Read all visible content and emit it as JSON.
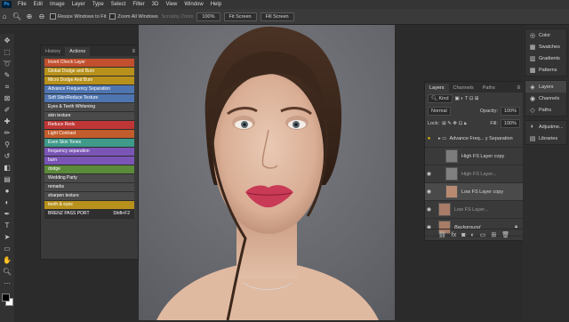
{
  "menubar": {
    "logo": "Ps",
    "items": [
      "File",
      "Edit",
      "Image",
      "Layer",
      "Type",
      "Select",
      "Filter",
      "3D",
      "View",
      "Window",
      "Help"
    ]
  },
  "options": {
    "resize_windows": "Resize Windows to Fit",
    "zoom_all": "Zoom All Windows",
    "scrubby_zoom": "Scrubby Zoom",
    "zoom_value": "100%",
    "fit_screen": "Fit Screen",
    "fill_screen": "Fill Screen"
  },
  "actions_panel": {
    "tabs": [
      "History",
      "Actions"
    ],
    "items": [
      {
        "label": "Invert Check Layer",
        "color": "#c2502f",
        "key": ""
      },
      {
        "label": "Global Dodge and Burn",
        "color": "#b8911c",
        "key": ""
      },
      {
        "label": "Micro Dodge And Burn",
        "color": "#b8911c",
        "key": ""
      },
      {
        "label": "Advance Frequency Separation",
        "color": "#4f75b0",
        "key": ""
      },
      {
        "label": "Soft Skin/Reduce Texture",
        "color": "#4f75b0",
        "key": ""
      },
      {
        "label": "Eyes & Teeth Whitening",
        "color": "#4a4a4a",
        "key": ""
      },
      {
        "label": "skin texture",
        "color": "#4a4a4a",
        "key": ""
      },
      {
        "label": "Reduce Reds",
        "color": "#bf3636",
        "key": ""
      },
      {
        "label": "Light Contrast",
        "color": "#c25c2c",
        "key": ""
      },
      {
        "label": "Even Skin Tones",
        "color": "#3f9a8a",
        "key": ""
      },
      {
        "label": "frequency separation",
        "color": "#7a55b6",
        "key": ""
      },
      {
        "label": "burn",
        "color": "#7a55b6",
        "key": ""
      },
      {
        "label": "dodge",
        "color": "#5b8a3a",
        "key": ""
      },
      {
        "label": "Wedding Party",
        "color": "#4a4a4a",
        "key": ""
      },
      {
        "label": "remarks",
        "color": "#4a4a4a",
        "key": ""
      },
      {
        "label": "sharpen texture",
        "color": "#4a4a4a",
        "key": ""
      },
      {
        "label": "teeth & eyes",
        "color": "#b8911c",
        "key": ""
      },
      {
        "label": "BRENZ PASS PORT",
        "color": "#2f2f2f",
        "key": "Shift+F2"
      }
    ]
  },
  "layers_panel": {
    "tabs": [
      "Layers",
      "Channels",
      "Paths"
    ],
    "kind_filter": "Kind",
    "blend_mode": "Normal",
    "opacity_label": "Opacity:",
    "opacity_value": "100%",
    "lock_label": "Lock:",
    "fill_label": "Fill:",
    "fill_value": "100%",
    "layers": [
      {
        "name": "Advance Freq... y Separation",
        "type": "group"
      },
      {
        "name": "High FS Layer copy",
        "type": "layer"
      },
      {
        "name": "High FS Layer...",
        "type": "layer"
      },
      {
        "name": "Low FS Layer copy",
        "type": "layer"
      },
      {
        "name": "Low FS Layer...",
        "type": "layer"
      },
      {
        "name": "Background",
        "type": "background"
      }
    ]
  },
  "right_dock": {
    "group1": [
      {
        "label": "Color",
        "icon": "color-wheel-icon"
      },
      {
        "label": "Swatches",
        "icon": "swatches-icon"
      },
      {
        "label": "Gradients",
        "icon": "gradient-icon"
      },
      {
        "label": "Patterns",
        "icon": "pattern-icon"
      }
    ],
    "group2": [
      {
        "label": "Layers",
        "icon": "layers-icon"
      },
      {
        "label": "Channels",
        "icon": "channels-icon"
      },
      {
        "label": "Paths",
        "icon": "paths-icon"
      }
    ],
    "group3": [
      {
        "label": "Adjustme...",
        "icon": "adjustment-icon"
      },
      {
        "label": "Libraries",
        "icon": "libraries-icon"
      }
    ]
  }
}
